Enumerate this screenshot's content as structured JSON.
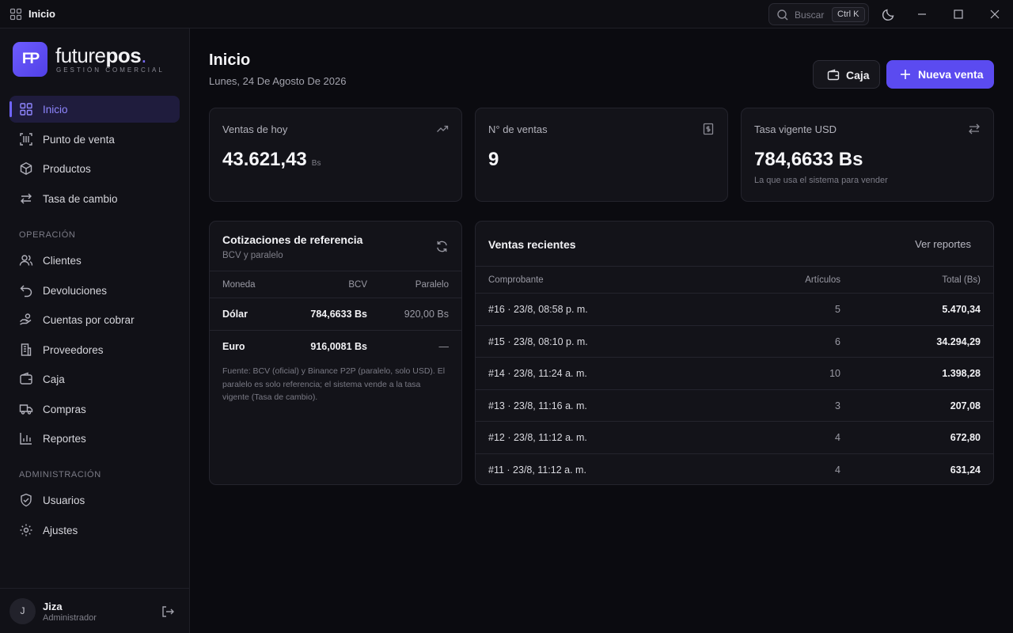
{
  "window": {
    "title": "Inicio",
    "search_placeholder": "Buscar",
    "shortcut": "Ctrl K"
  },
  "brand": {
    "logo_initials": "FP",
    "name_part1": "future",
    "name_part2": "pos",
    "dot": ".",
    "tagline": "GESTIÓN COMERCIAL"
  },
  "sidebar": {
    "items": [
      {
        "label": "Inicio"
      },
      {
        "label": "Punto de venta"
      },
      {
        "label": "Productos"
      },
      {
        "label": "Tasa de cambio"
      }
    ],
    "section_operacion": "OPERACIÓN",
    "operacion_items": [
      {
        "label": "Clientes"
      },
      {
        "label": "Devoluciones"
      },
      {
        "label": "Cuentas por cobrar"
      },
      {
        "label": "Proveedores"
      },
      {
        "label": "Caja"
      },
      {
        "label": "Compras"
      },
      {
        "label": "Reportes"
      }
    ],
    "section_admin": "ADMINISTRACIÓN",
    "admin_items": [
      {
        "label": "Usuarios"
      },
      {
        "label": "Ajustes"
      }
    ]
  },
  "user": {
    "initial": "J",
    "name": "Jiza",
    "role": "Administrador"
  },
  "header": {
    "title": "Inicio",
    "date": "Lunes, 24 De Agosto De 2026",
    "caja_label": "Caja",
    "nueva_venta_label": "Nueva venta"
  },
  "stats": [
    {
      "label": "Ventas de hoy",
      "value": "43.621,43",
      "unit": "Bs"
    },
    {
      "label": "N° de ventas",
      "value": "9"
    },
    {
      "label": "Tasa vigente USD",
      "value": "784,6633 Bs",
      "note": "La que usa el sistema para vender"
    }
  ],
  "quotes": {
    "title": "Cotizaciones de referencia",
    "subtitle": "BCV y paralelo",
    "columns": [
      "Moneda",
      "BCV",
      "Paralelo"
    ],
    "rows": [
      {
        "moneda": "Dólar",
        "bcv": "784,6633 Bs",
        "paralelo": "920,00 Bs"
      },
      {
        "moneda": "Euro",
        "bcv": "916,0081 Bs",
        "paralelo": "—"
      }
    ],
    "note": "Fuente: BCV (oficial) y Binance P2P (paralelo, solo USD). El paralelo es solo referencia; el sistema vende a la tasa vigente (Tasa de cambio)."
  },
  "recent": {
    "title": "Ventas recientes",
    "link": "Ver reportes",
    "columns": [
      "Comprobante",
      "Artículos",
      "Total (Bs)"
    ],
    "rows": [
      {
        "comprobante": "#16 · 23/8, 08:58 p. m.",
        "articulos": "5",
        "total": "5.470,34"
      },
      {
        "comprobante": "#15 · 23/8, 08:10 p. m.",
        "articulos": "6",
        "total": "34.294,29"
      },
      {
        "comprobante": "#14 · 23/8, 11:24 a. m.",
        "articulos": "10",
        "total": "1.398,28"
      },
      {
        "comprobante": "#13 · 23/8, 11:16 a. m.",
        "articulos": "3",
        "total": "207,08"
      },
      {
        "comprobante": "#12 · 23/8, 11:12 a. m.",
        "articulos": "4",
        "total": "672,80"
      },
      {
        "comprobante": "#11 · 23/8, 11:12 a. m.",
        "articulos": "4",
        "total": "631,24"
      }
    ]
  },
  "colors": {
    "accent": "#5b4bf0",
    "background": "#0b0b10",
    "card": "#131319"
  }
}
